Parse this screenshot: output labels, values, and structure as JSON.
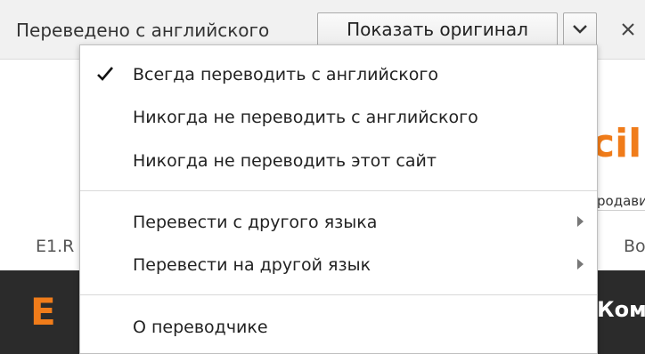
{
  "translate_bar": {
    "label": "Переведено с английского",
    "show_original_label": "Показать оригинал",
    "dropdown_icon": "chevron-down-icon",
    "close_label": "✕"
  },
  "background_page": {
    "logo_fragment": "cil",
    "subtitle_fragment": "родави",
    "left_fragment": "E1.R",
    "right_fragment": "Во",
    "dark_left_fragment": "E",
    "dark_right_fragment": "Комм"
  },
  "menu": {
    "items": [
      {
        "label": "Всегда переводить с английского",
        "checked": true
      },
      {
        "label": "Никогда не переводить с английского"
      },
      {
        "label": "Никогда не переводить этот сайт"
      },
      {
        "label": "Перевести с другого языка",
        "submenu": true
      },
      {
        "label": "Перевести на другой язык",
        "submenu": true
      },
      {
        "label": "О переводчике"
      }
    ]
  },
  "colors": {
    "accent": "#f07c1a",
    "dark_band": "#2b2b2b",
    "bar_bg": "#f1f1f1"
  }
}
